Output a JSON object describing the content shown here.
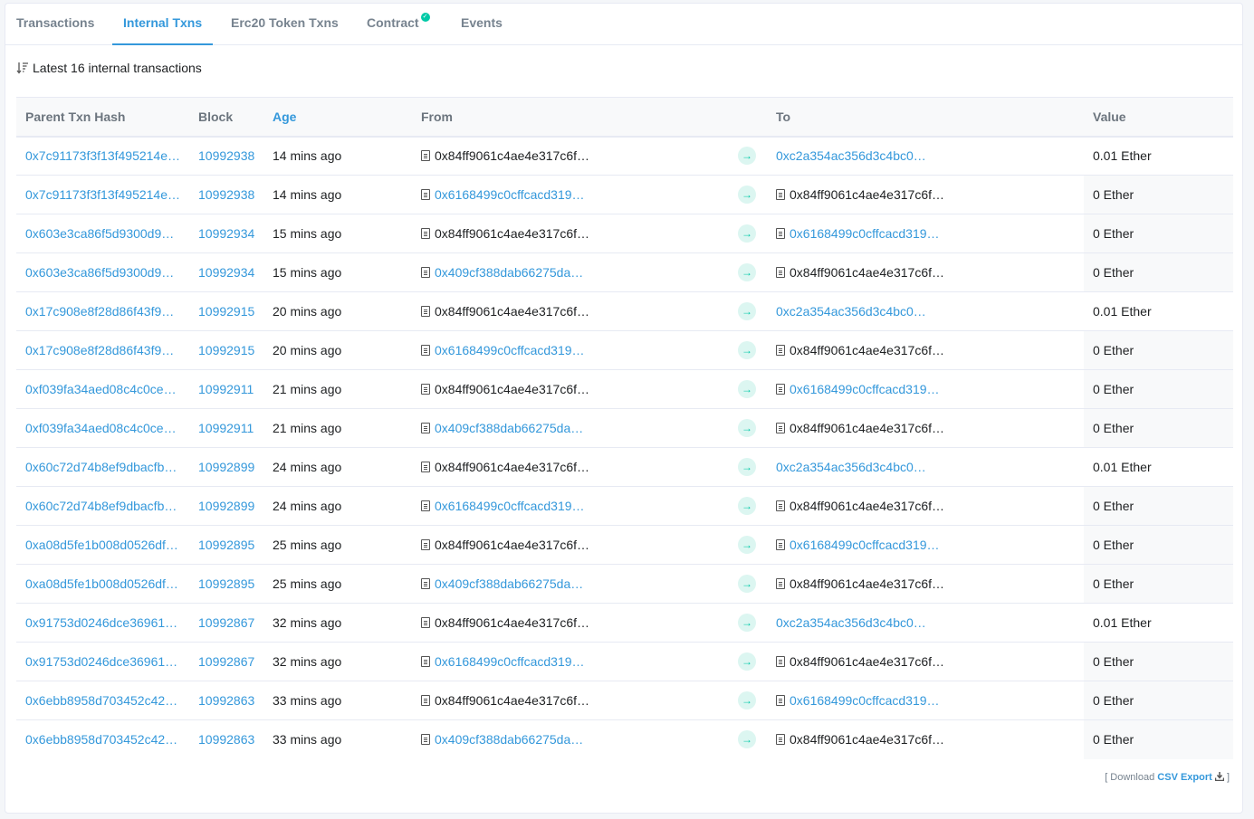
{
  "tabs": [
    {
      "label": "Transactions",
      "active": false
    },
    {
      "label": "Internal Txns",
      "active": true
    },
    {
      "label": "Erc20 Token Txns",
      "active": false
    },
    {
      "label": "Contract",
      "active": false,
      "verified": true
    },
    {
      "label": "Events",
      "active": false
    }
  ],
  "summary": "Latest 16 internal transactions",
  "columns": {
    "parent": "Parent Txn Hash",
    "block": "Block",
    "age": "Age",
    "from": "From",
    "to": "To",
    "value": "Value"
  },
  "rows": [
    {
      "hash": "0x7c91173f3f13f495214e…",
      "block": "10992938",
      "age": "14 mins ago",
      "from": "0x84ff9061c4ae4e317c6f…",
      "from_link": false,
      "from_contract": true,
      "to": "0xc2a354ac356d3c4bc0…",
      "to_link": true,
      "to_contract": false,
      "value": "0.01 Ether"
    },
    {
      "hash": "0x7c91173f3f13f495214e…",
      "block": "10992938",
      "age": "14 mins ago",
      "from": "0x6168499c0cffcacd319…",
      "from_link": true,
      "from_contract": true,
      "to": "0x84ff9061c4ae4e317c6f…",
      "to_link": false,
      "to_contract": true,
      "value": "0 Ether"
    },
    {
      "hash": "0x603e3ca86f5d9300d9…",
      "block": "10992934",
      "age": "15 mins ago",
      "from": "0x84ff9061c4ae4e317c6f…",
      "from_link": false,
      "from_contract": true,
      "to": "0x6168499c0cffcacd319…",
      "to_link": true,
      "to_contract": true,
      "value": "0 Ether"
    },
    {
      "hash": "0x603e3ca86f5d9300d9…",
      "block": "10992934",
      "age": "15 mins ago",
      "from": "0x409cf388dab66275da…",
      "from_link": true,
      "from_contract": true,
      "to": "0x84ff9061c4ae4e317c6f…",
      "to_link": false,
      "to_contract": true,
      "value": "0 Ether"
    },
    {
      "hash": "0x17c908e8f28d86f43f9…",
      "block": "10992915",
      "age": "20 mins ago",
      "from": "0x84ff9061c4ae4e317c6f…",
      "from_link": false,
      "from_contract": true,
      "to": "0xc2a354ac356d3c4bc0…",
      "to_link": true,
      "to_contract": false,
      "value": "0.01 Ether"
    },
    {
      "hash": "0x17c908e8f28d86f43f9…",
      "block": "10992915",
      "age": "20 mins ago",
      "from": "0x6168499c0cffcacd319…",
      "from_link": true,
      "from_contract": true,
      "to": "0x84ff9061c4ae4e317c6f…",
      "to_link": false,
      "to_contract": true,
      "value": "0 Ether"
    },
    {
      "hash": "0xf039fa34aed08c4c0ce…",
      "block": "10992911",
      "age": "21 mins ago",
      "from": "0x84ff9061c4ae4e317c6f…",
      "from_link": false,
      "from_contract": true,
      "to": "0x6168499c0cffcacd319…",
      "to_link": true,
      "to_contract": true,
      "value": "0 Ether"
    },
    {
      "hash": "0xf039fa34aed08c4c0ce…",
      "block": "10992911",
      "age": "21 mins ago",
      "from": "0x409cf388dab66275da…",
      "from_link": true,
      "from_contract": true,
      "to": "0x84ff9061c4ae4e317c6f…",
      "to_link": false,
      "to_contract": true,
      "value": "0 Ether"
    },
    {
      "hash": "0x60c72d74b8ef9dbacfb…",
      "block": "10992899",
      "age": "24 mins ago",
      "from": "0x84ff9061c4ae4e317c6f…",
      "from_link": false,
      "from_contract": true,
      "to": "0xc2a354ac356d3c4bc0…",
      "to_link": true,
      "to_contract": false,
      "value": "0.01 Ether"
    },
    {
      "hash": "0x60c72d74b8ef9dbacfb…",
      "block": "10992899",
      "age": "24 mins ago",
      "from": "0x6168499c0cffcacd319…",
      "from_link": true,
      "from_contract": true,
      "to": "0x84ff9061c4ae4e317c6f…",
      "to_link": false,
      "to_contract": true,
      "value": "0 Ether"
    },
    {
      "hash": "0xa08d5fe1b008d0526df…",
      "block": "10992895",
      "age": "25 mins ago",
      "from": "0x84ff9061c4ae4e317c6f…",
      "from_link": false,
      "from_contract": true,
      "to": "0x6168499c0cffcacd319…",
      "to_link": true,
      "to_contract": true,
      "value": "0 Ether"
    },
    {
      "hash": "0xa08d5fe1b008d0526df…",
      "block": "10992895",
      "age": "25 mins ago",
      "from": "0x409cf388dab66275da…",
      "from_link": true,
      "from_contract": true,
      "to": "0x84ff9061c4ae4e317c6f…",
      "to_link": false,
      "to_contract": true,
      "value": "0 Ether"
    },
    {
      "hash": "0x91753d0246dce36961…",
      "block": "10992867",
      "age": "32 mins ago",
      "from": "0x84ff9061c4ae4e317c6f…",
      "from_link": false,
      "from_contract": true,
      "to": "0xc2a354ac356d3c4bc0…",
      "to_link": true,
      "to_contract": false,
      "value": "0.01 Ether"
    },
    {
      "hash": "0x91753d0246dce36961…",
      "block": "10992867",
      "age": "32 mins ago",
      "from": "0x6168499c0cffcacd319…",
      "from_link": true,
      "from_contract": true,
      "to": "0x84ff9061c4ae4e317c6f…",
      "to_link": false,
      "to_contract": true,
      "value": "0 Ether"
    },
    {
      "hash": "0x6ebb8958d703452c42…",
      "block": "10992863",
      "age": "33 mins ago",
      "from": "0x84ff9061c4ae4e317c6f…",
      "from_link": false,
      "from_contract": true,
      "to": "0x6168499c0cffcacd319…",
      "to_link": true,
      "to_contract": true,
      "value": "0 Ether"
    },
    {
      "hash": "0x6ebb8958d703452c42…",
      "block": "10992863",
      "age": "33 mins ago",
      "from": "0x409cf388dab66275da…",
      "from_link": true,
      "from_contract": true,
      "to": "0x84ff9061c4ae4e317c6f…",
      "to_link": false,
      "to_contract": true,
      "value": "0 Ether"
    }
  ],
  "footer": {
    "open": "[ Download",
    "csv": "CSV Export",
    "close": "]"
  },
  "colors": {
    "accent": "#3498db",
    "success": "#00c9a7",
    "muted": "#77838f"
  }
}
